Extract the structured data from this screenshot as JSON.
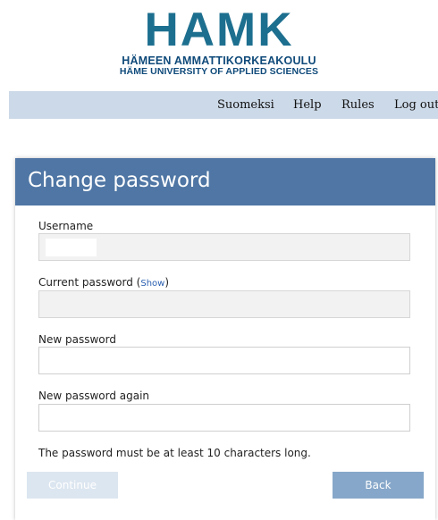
{
  "logo": {
    "main": "HAMK",
    "sub1": "HÄMEEN AMMATTIKORKEAKOULU",
    "sub2": "HÄME UNIVERSITY OF APPLIED SCIENCES"
  },
  "nav": {
    "suomeksi": "Suomeksi",
    "help": "Help",
    "rules": "Rules",
    "logout": "Log out"
  },
  "form": {
    "title": "Change password",
    "username_label": "Username",
    "current_label": "Current password (",
    "show_link": "Show",
    "current_label_close": ")",
    "new_label": "New password",
    "new_again_label": "New password again",
    "hint": "The password must be at least 10 characters long.",
    "continue_label": "Continue",
    "back_label": "Back"
  },
  "colors": {
    "brand": "#1d6f8f",
    "nav_bg": "#ccd9e8",
    "header_bg": "#4f76a4",
    "back_button": "#86a7c9",
    "continue_disabled": "#dce6f0"
  }
}
